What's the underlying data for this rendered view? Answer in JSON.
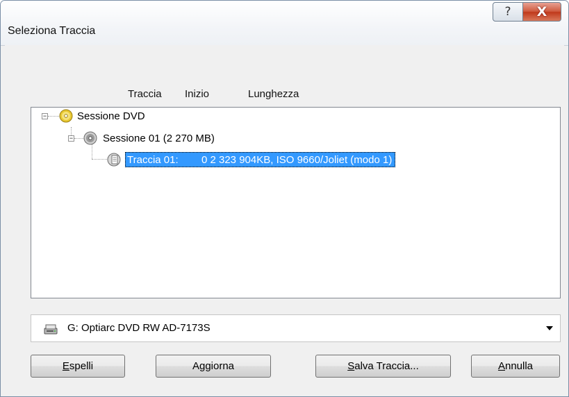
{
  "window": {
    "title": "Seleziona Traccia",
    "help_glyph": "?",
    "close_glyph": "X"
  },
  "columns": {
    "track": "Traccia",
    "start": "Inizio",
    "length": "Lunghezza"
  },
  "tree": {
    "root": {
      "label": "Sessione DVD",
      "icon": "dvd-disc-icon",
      "expander": "−"
    },
    "session": {
      "label": "Sessione 01 (2 270 MB)",
      "icon": "cd-disc-icon",
      "expander": "−"
    },
    "track": {
      "label": "Traccia 01:        0 2 323 904KB, ISO 9660/Joliet (modo 1)",
      "icon": "track-file-icon"
    }
  },
  "drive": {
    "selected": "G: Optiarc DVD RW AD-7173S",
    "icon": "optical-drive-icon"
  },
  "buttons": {
    "eject_mnemonic": "E",
    "eject_rest": "spelli",
    "refresh_pre": "A",
    "refresh_mnemonic": "g",
    "refresh_rest": "giorna",
    "save_mnemonic": "S",
    "save_rest": "alva Traccia...",
    "cancel_mnemonic": "A",
    "cancel_rest": "nnulla"
  },
  "colors": {
    "selection": "#3399ff",
    "close_button": "#c0391b"
  }
}
